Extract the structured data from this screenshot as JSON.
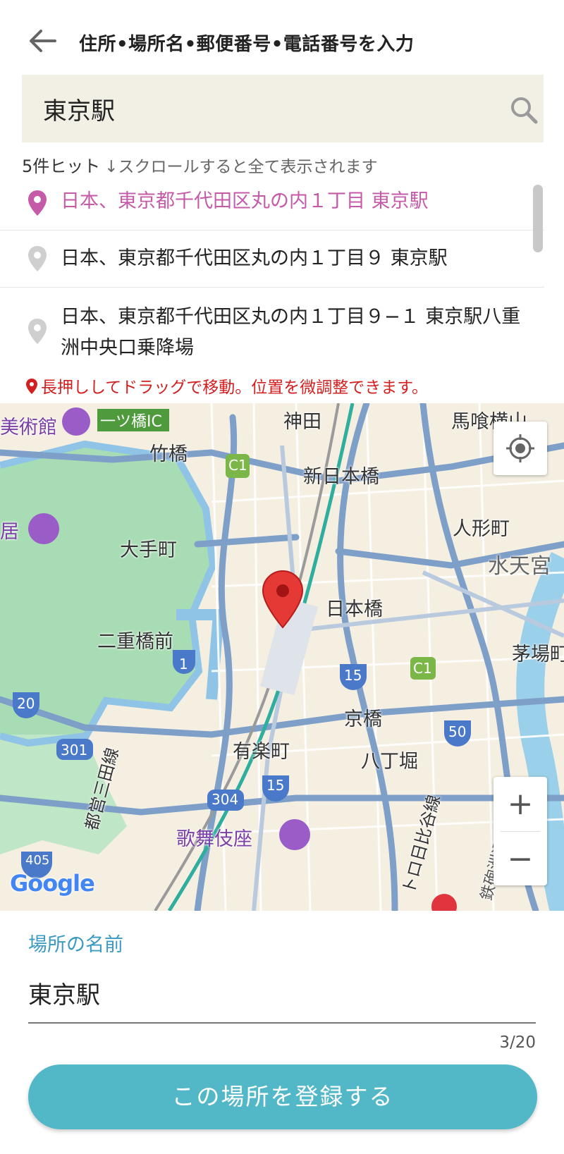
{
  "header": {
    "title": "住所•場所名•郵便番号•電話番号を入力"
  },
  "search": {
    "value": "東京駅"
  },
  "results": {
    "count_text": "5件ヒット",
    "scroll_note": "↓スクロールすると全て表示されます",
    "items": [
      {
        "address": "日本、東京都千代田区丸の内１丁目 東京駅",
        "selected": true
      },
      {
        "address": "日本、東京都千代田区丸の内１丁目９ 東京駅",
        "selected": false
      },
      {
        "address": "日本、東京都千代田区丸の内１丁目９−１ 東京駅八重洲中央口乗降場",
        "selected": false
      }
    ]
  },
  "hint": "長押ししてドラッグで移動。位置を微調整できます。",
  "map": {
    "labels": {
      "museum": "美術館",
      "hitotsubashi_ic": "一ツ橋IC",
      "kanda": "神田",
      "bakuro": "馬喰横山",
      "takebashi": "竹橋",
      "c1_a": "C1",
      "shin_nihonbashi": "新日本橋",
      "kyo": "居",
      "otemachi": "大手町",
      "ningyocho": "人形町",
      "suitengu": "水天宮",
      "nihonbashi": "日本橋",
      "nijubashimae": "二重橋前",
      "kayabacho": "茅場町",
      "r1": "1",
      "r15a": "15",
      "c1_b": "C1",
      "r20": "20",
      "kyobashi": "京橋",
      "r50": "50",
      "r301": "301",
      "yurakucho": "有楽町",
      "hatchobori": "八丁堀",
      "r304": "304",
      "r15b": "15",
      "kabukiza": "歌舞伎座",
      "r405": "405",
      "mita_line": "都営三田線",
      "hibiya_line": "トロ日比谷線",
      "sumida": "鉄砲洲通り"
    },
    "logo": "Google",
    "zoom_in": "+",
    "zoom_out": "−"
  },
  "place_name": {
    "label": "場所の名前",
    "value": "東京駅",
    "counter": "3/20"
  },
  "submit_label": "この場所を登録する",
  "colors": {
    "accent": "#52b8c7",
    "selected": "#c45aa8",
    "hint": "#d21f1f",
    "label": "#3a9abf"
  }
}
